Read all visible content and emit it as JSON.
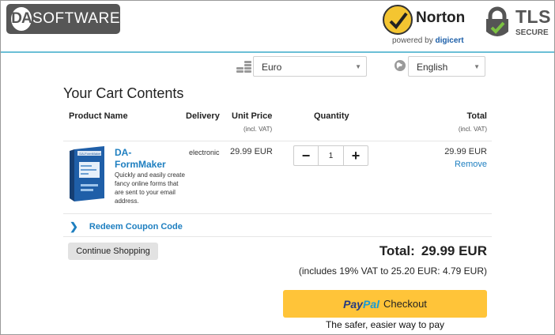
{
  "brand": {
    "logo_da": "DA",
    "logo_text": "SOFTWARE"
  },
  "badges": {
    "norton_word": "Norton",
    "norton_sub_prefix": "powered by ",
    "norton_sub_brand": "digicert",
    "tls_word": "TLS",
    "tls_sub": "SECURE"
  },
  "selectors": {
    "currency": {
      "value": "Euro",
      "icon": "coins-icon"
    },
    "language": {
      "value": "English",
      "icon": "globe-icon"
    }
  },
  "cart": {
    "title": "Your Cart Contents",
    "headers": {
      "product": "Product Name",
      "delivery": "Delivery",
      "unit_price": "Unit Price",
      "unit_price_sub": "(incl. VAT)",
      "quantity": "Quantity",
      "total": "Total",
      "total_sub": "(incl. VAT)"
    },
    "items": [
      {
        "name": "DA-FormMaker",
        "description": "Quickly and easily create fancy online forms that are sent to your email address.",
        "delivery": "electronic",
        "unit_price": "29.99 EUR",
        "quantity": "1",
        "total": "29.99 EUR",
        "remove_label": "Remove",
        "box_label": "DA-FormMaker"
      }
    ],
    "coupon_label": "Redeem Coupon Code",
    "continue_label": "Continue Shopping",
    "total_label": "Total:",
    "total_amount": "29.99 EUR",
    "vat_note": "(includes 19% VAT to 25.20 EUR: 4.79 EUR)",
    "paypal_part1": "Pay",
    "paypal_part2": "Pal",
    "checkout_label": "Checkout",
    "safer_note": "The safer, easier way to pay"
  },
  "colors": {
    "accent_blue": "#1e7fc0",
    "header_line": "#6bbfd6",
    "paypal_yellow": "#ffc439"
  }
}
